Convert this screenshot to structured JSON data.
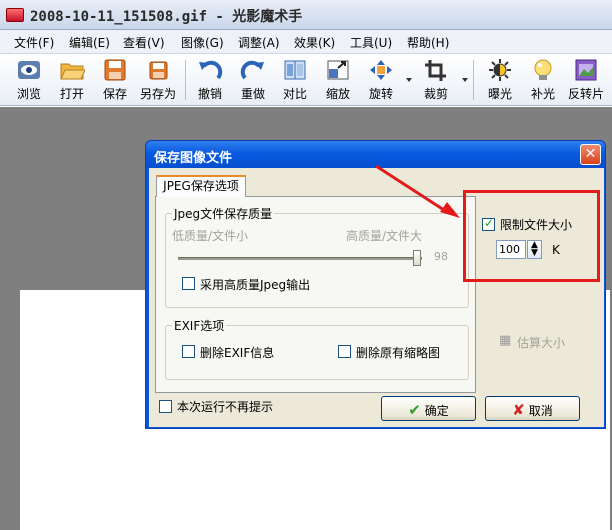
{
  "window": {
    "title": "2008-10-11_151508.gif - 光影魔术手"
  },
  "menu": [
    "文件(F)",
    "编辑(E)",
    "查看(V)",
    "图像(G)",
    "调整(A)",
    "效果(K)",
    "工具(U)",
    "帮助(H)"
  ],
  "toolbar": {
    "buttons": [
      {
        "label": "浏览",
        "icon": "eye-icon"
      },
      {
        "label": "打开",
        "icon": "folder-open-icon"
      },
      {
        "label": "保存",
        "icon": "floppy-disk-icon"
      },
      {
        "label": "另存为",
        "icon": "save-as-icon"
      },
      {
        "label": "撤销",
        "icon": "undo-arrow-icon"
      },
      {
        "label": "重做",
        "icon": "redo-arrow-icon"
      },
      {
        "label": "对比",
        "icon": "compare-icon"
      },
      {
        "label": "缩放",
        "icon": "resize-icon"
      },
      {
        "label": "旋转",
        "icon": "rotate-icon"
      },
      {
        "label": "裁剪",
        "icon": "crop-icon"
      },
      {
        "label": "曝光",
        "icon": "sun-exposure-icon"
      },
      {
        "label": "补光",
        "icon": "lightbulb-icon"
      },
      {
        "label": "反转片",
        "icon": "film-icon"
      }
    ]
  },
  "dialog": {
    "title": "保存图像文件",
    "tab_label": "JPEG保存选项",
    "quality_group": {
      "title": "Jpeg文件保存质量",
      "low_label": "低质量/文件小",
      "high_label": "高质量/文件大",
      "value": "98",
      "value_fraction": 0.98,
      "high_quality_checkbox": "采用高质量Jpeg输出",
      "high_quality_checked": false
    },
    "exif_group": {
      "title": "EXIF选项",
      "remove_exif": "删除EXIF信息",
      "remove_thumbnail": "删除原有缩略图"
    },
    "limit_size": {
      "label": "限制文件大小",
      "checked": true,
      "value": "100",
      "unit": "K"
    },
    "estimate_button": "估算大小",
    "dont_show_label": "本次运行不再提示",
    "ok_button": "确定",
    "cancel_button": "取消"
  },
  "colors": {
    "annotation": "#e41b1b",
    "dialog_title": "#0a5ae0",
    "workspace": "#7f7f7f"
  }
}
